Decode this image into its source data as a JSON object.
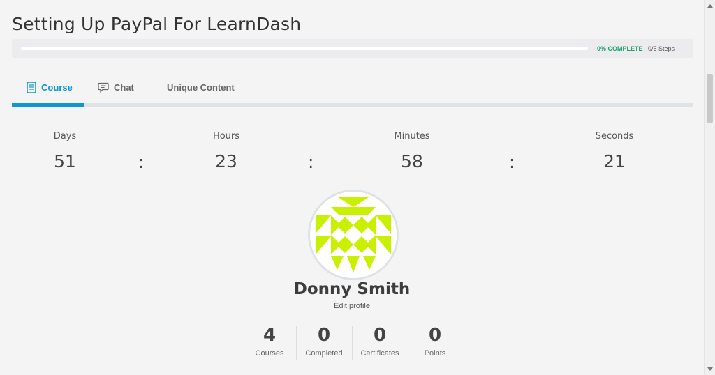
{
  "course": {
    "title": "Setting Up PayPal For LearnDash"
  },
  "progress": {
    "percent_label": "0% COMPLETE",
    "steps_label": "0/5 Steps",
    "fraction": 0
  },
  "tabs": [
    {
      "label": "Course",
      "icon": "document-icon",
      "active": true
    },
    {
      "label": "Chat",
      "icon": "chat-bubble-icon",
      "active": false
    },
    {
      "label": "Unique Content",
      "icon": "",
      "active": false
    }
  ],
  "countdown": {
    "days": {
      "label": "Days",
      "value": "51"
    },
    "hours": {
      "label": "Hours",
      "value": "23"
    },
    "minutes": {
      "label": "Minutes",
      "value": "58"
    },
    "seconds": {
      "label": "Seconds",
      "value": "21"
    },
    "separator": ":"
  },
  "profile": {
    "name": "Donny Smith",
    "edit_label": "Edit profile",
    "avatar_color": "#c8f000"
  },
  "stats": [
    {
      "value": "4",
      "label": "Courses"
    },
    {
      "value": "0",
      "label": "Completed"
    },
    {
      "value": "0",
      "label": "Certificates"
    },
    {
      "value": "0",
      "label": "Points"
    }
  ],
  "colors": {
    "accent": "#0e96d6",
    "complete_green": "#18a06b"
  }
}
